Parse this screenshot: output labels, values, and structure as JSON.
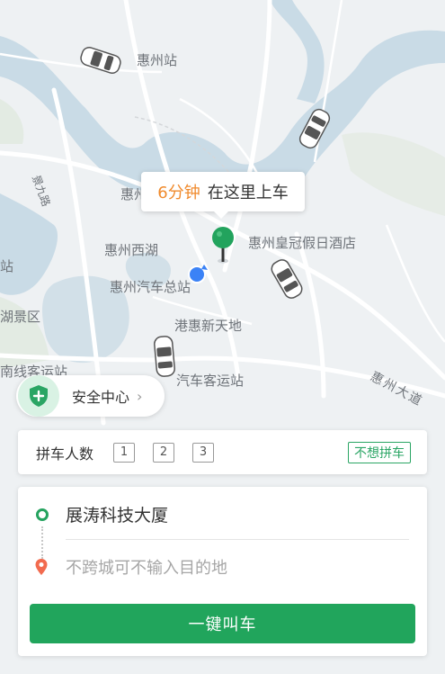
{
  "map": {
    "labels": {
      "station": "惠州站",
      "lake_west": "惠州西湖",
      "hotel": "惠州皇冠假日酒店",
      "bus_terminal_center": "惠州汽车总站",
      "ganghui": "港惠新天地",
      "nearby_bus": "汽车客运站",
      "west_line": "南线客运站",
      "scenic": "湖景区",
      "stop": "站",
      "partial": "惠州",
      "road": "惠州大道",
      "road_left": "景九路"
    }
  },
  "pickup_bubble": {
    "eta": "6分钟",
    "text": "在这里上车"
  },
  "safety": {
    "label": "安全中心"
  },
  "carpool": {
    "title": "拼车人数",
    "options": [
      "1",
      "2",
      "3"
    ],
    "no_pool": "不想拼车"
  },
  "route": {
    "origin": "展涛科技大厦",
    "destination_placeholder": "不跨城可不输入目的地"
  },
  "cta": {
    "label": "一键叫车"
  },
  "colors": {
    "accent_green": "#21a55c",
    "eta_orange": "#f08a2c",
    "water": "#c9dbe6",
    "location_blue": "#3b82f6"
  }
}
